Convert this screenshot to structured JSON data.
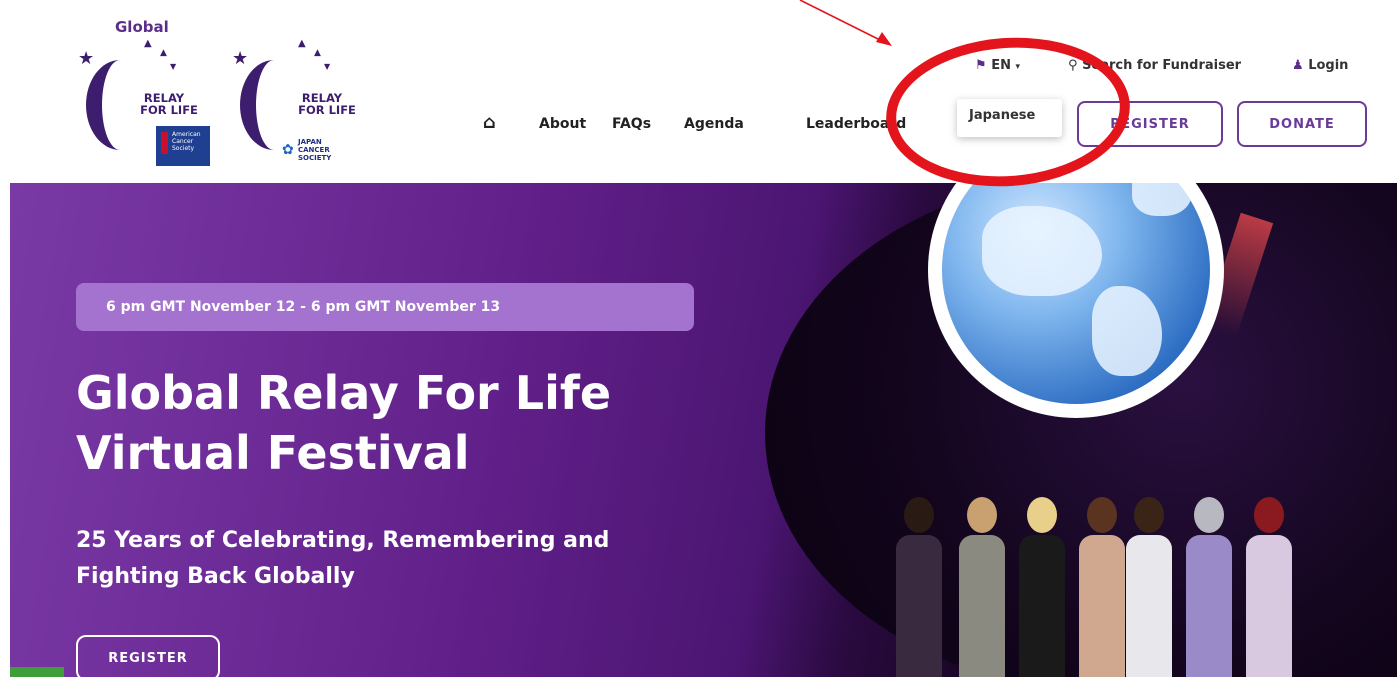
{
  "header": {
    "logo_global_text": "Global",
    "logo1": {
      "line1": "RELAY",
      "line2": "FOR LIFE",
      "badge": "American Cancer Society"
    },
    "logo2": {
      "line1": "RELAY",
      "line2": "FOR LIFE",
      "badge": "JAPAN CANCER SOCIETY"
    },
    "language": {
      "label": "EN",
      "options": [
        "Japanese"
      ]
    },
    "search_label": "Search for Fundraiser",
    "login_label": "Login",
    "nav": [
      {
        "label": "About"
      },
      {
        "label": "FAQs"
      },
      {
        "label": "Agenda"
      },
      {
        "label": "Leaderboard"
      }
    ],
    "register_label": "REGISTER",
    "donate_label": "DONATE"
  },
  "hero": {
    "date_range": "6 pm GMT November 12 - 6 pm GMT November 13",
    "title_line1": "Global Relay For Life",
    "title_line2": "Virtual Festival",
    "subtitle_line1": "25 Years of Celebrating, Remembering and",
    "subtitle_line2": "Fighting Back Globally",
    "register_label": "REGISTER"
  },
  "colors": {
    "brand_purple": "#6a3a9a",
    "annotation_red": "#e3141b"
  }
}
